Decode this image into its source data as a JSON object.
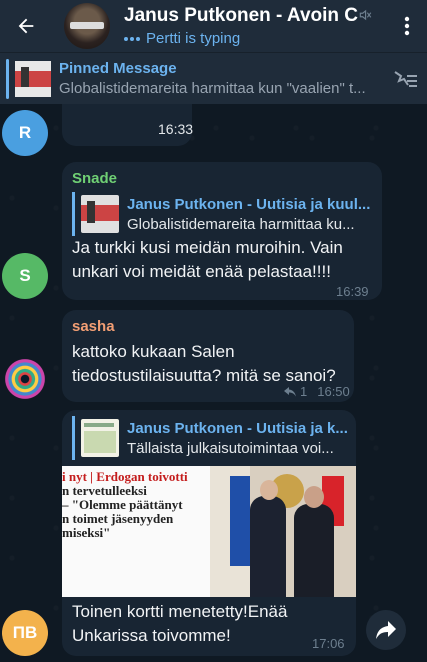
{
  "header": {
    "title": "Janus Putkonen - Avoin C",
    "status": "Pertti is typing"
  },
  "pinned": {
    "title": "Pinned Message",
    "text": "Globalistidemareita harmittaa kun \"vaalien\" t..."
  },
  "messages": [
    {
      "avatar_initial": "R",
      "avatar_color": "#4a9fe0",
      "time": "16:33"
    },
    {
      "sender": "Snade",
      "sender_color": "#6fcf74",
      "avatar_initial": "S",
      "avatar_color": "#56b966",
      "reply_name": "Janus Putkonen - Uutisia ja kuul...",
      "reply_text": "Globalistidemareita harmittaa ku...",
      "text_line1": "Ja turkki kusi meidän muroihin. Vain",
      "text_line2": "unkari voi meidät enää pelastaa!!!!",
      "time": "16:39"
    },
    {
      "sender": "sasha",
      "sender_color": "#f29e74",
      "text_line1": "kattoko kukaan Salen",
      "text_line2": "tiedostustilaisuutta? mitä se sanoi?",
      "reply_count": "1",
      "time": "16:50"
    },
    {
      "avatar_initial": "ПВ",
      "avatar_color": "#f3b24c",
      "reply_name": "Janus Putkonen - Uutisia ja k...",
      "reply_text": "Tällaista julkaisutoimintaa voi...",
      "photo_lines": [
        "i nyt | Erdogan toivotti",
        "n tervetulleeksi",
        "– \"Olemme päättänyt",
        "n toimet jäsenyyden",
        "miseksi\""
      ],
      "text_line1": "Toinen kortti menetetty!Enää",
      "text_line2": "Unkarissa toivomme!",
      "time": "17:06"
    }
  ],
  "colors": {
    "accent": "#6cb3ef",
    "bubble": "#182533",
    "header": "#1f2c3a"
  }
}
